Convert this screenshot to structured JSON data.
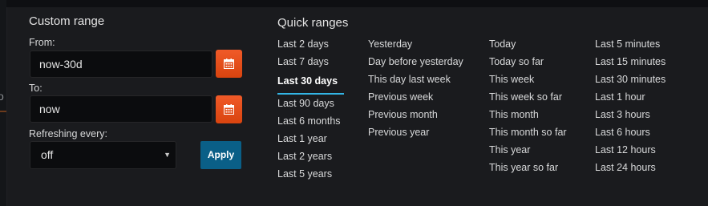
{
  "custom_range": {
    "title": "Custom range",
    "from_label": "From:",
    "from_value": "now-30d",
    "to_label": "To:",
    "to_value": "now",
    "refresh_label": "Refreshing every:",
    "refresh_value": "off",
    "apply_label": "Apply"
  },
  "quick_ranges": {
    "title": "Quick ranges",
    "columns": [
      [
        "Last 2 days",
        "Last 7 days",
        "Last 30 days",
        "Last 90 days",
        "Last 6 months",
        "Last 1 year",
        "Last 2 years",
        "Last 5 years"
      ],
      [
        "Yesterday",
        "Day before yesterday",
        "This day last week",
        "Previous week",
        "Previous month",
        "Previous year"
      ],
      [
        "Today",
        "Today so far",
        "This week",
        "This week so far",
        "This month",
        "This month so far",
        "This year",
        "This year so far"
      ],
      [
        "Last 5 minutes",
        "Last 15 minutes",
        "Last 30 minutes",
        "Last 1 hour",
        "Last 3 hours",
        "Last 6 hours",
        "Last 12 hours",
        "Last 24 hours"
      ]
    ],
    "active": "Last 30 days"
  },
  "icons": {
    "calendar": "calendar-icon",
    "dropdown": "chevron-down-icon"
  },
  "colors": {
    "panel_bg": "#1a1b1e",
    "accent_orange": "#e8501c",
    "apply_blue": "#0a5f87",
    "active_underline": "#33b5e5"
  }
}
